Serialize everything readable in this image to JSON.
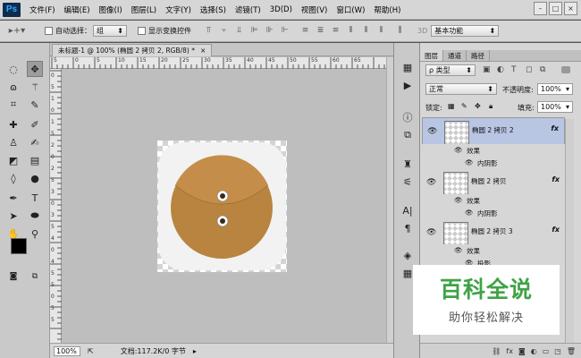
{
  "app": {
    "logo": "Ps"
  },
  "menu": [
    "文件(F)",
    "编辑(E)",
    "图像(I)",
    "图层(L)",
    "文字(Y)",
    "选择(S)",
    "滤镜(T)",
    "3D(D)",
    "视图(V)",
    "窗口(W)",
    "帮助(H)"
  ],
  "window_controls": {
    "minimize": "–",
    "maximize": "□",
    "close": "×"
  },
  "options": {
    "auto_select_label": "自动选择：",
    "auto_select_value": "组",
    "show_transform_label": "显示变换控件",
    "workspace_prefix": "3D",
    "workspace_value": "基本功能"
  },
  "document": {
    "tab_title": "未标题-1 @ 100% (椭圆 2 拷贝 2, RGB/8) *",
    "tab_close": "×",
    "zoom": "100%",
    "doc_info": "文档:117.2K/0 字节"
  },
  "ruler": {
    "top_labels": [
      "5",
      "0",
      "5",
      "10",
      "15",
      "20",
      "25",
      "30",
      "35",
      "40",
      "45",
      "50",
      "55",
      "60",
      "65"
    ],
    "left_labels": [
      "0",
      "5",
      "1",
      "0",
      "1",
      "5",
      "2",
      "0",
      "2",
      "5",
      "3",
      "0",
      "3",
      "5",
      "4",
      "0",
      "4",
      "5",
      "5",
      "0",
      "5",
      "5"
    ]
  },
  "panel": {
    "tabs": [
      "图层",
      "通道",
      "路径"
    ],
    "filter_label": "ρ 类型",
    "blend_mode": "正常",
    "opacity_label": "不透明度:",
    "opacity_value": "100%",
    "lock_label": "锁定:",
    "fill_label": "填充:",
    "fill_value": "100%",
    "layers": [
      {
        "name": "椭圆 2 拷贝 2",
        "effects_label": "效果",
        "effect": "内阴影",
        "fx": "fx",
        "selected": true
      },
      {
        "name": "椭圆 2 拷贝",
        "effects_label": "效果",
        "effect": "内阴影",
        "fx": "fx",
        "selected": false
      },
      {
        "name": "椭圆 2 拷贝 3",
        "effects_label": "效果",
        "effect": "投影",
        "fx": "fx",
        "selected": false
      }
    ]
  },
  "watermark": {
    "title": "百科全说",
    "subtitle": "助你轻松解决"
  },
  "colors": {
    "envelope": "#b98440",
    "envelope_flap": "#c48e4a",
    "selection": "#b8c6e3",
    "watermark_green": "#3fa345"
  },
  "icons": {
    "tools": [
      "marquee-icon",
      "move-icon",
      "lasso-icon",
      "magic-wand-icon",
      "crop-icon",
      "eyedropper-icon",
      "healing-icon",
      "brush-icon",
      "stamp-icon",
      "history-brush-icon",
      "eraser-icon",
      "gradient-icon",
      "blur-icon",
      "dodge-icon",
      "pen-icon",
      "type-icon",
      "path-select-icon",
      "ellipse-icon",
      "hand-icon",
      "zoom-icon"
    ]
  }
}
